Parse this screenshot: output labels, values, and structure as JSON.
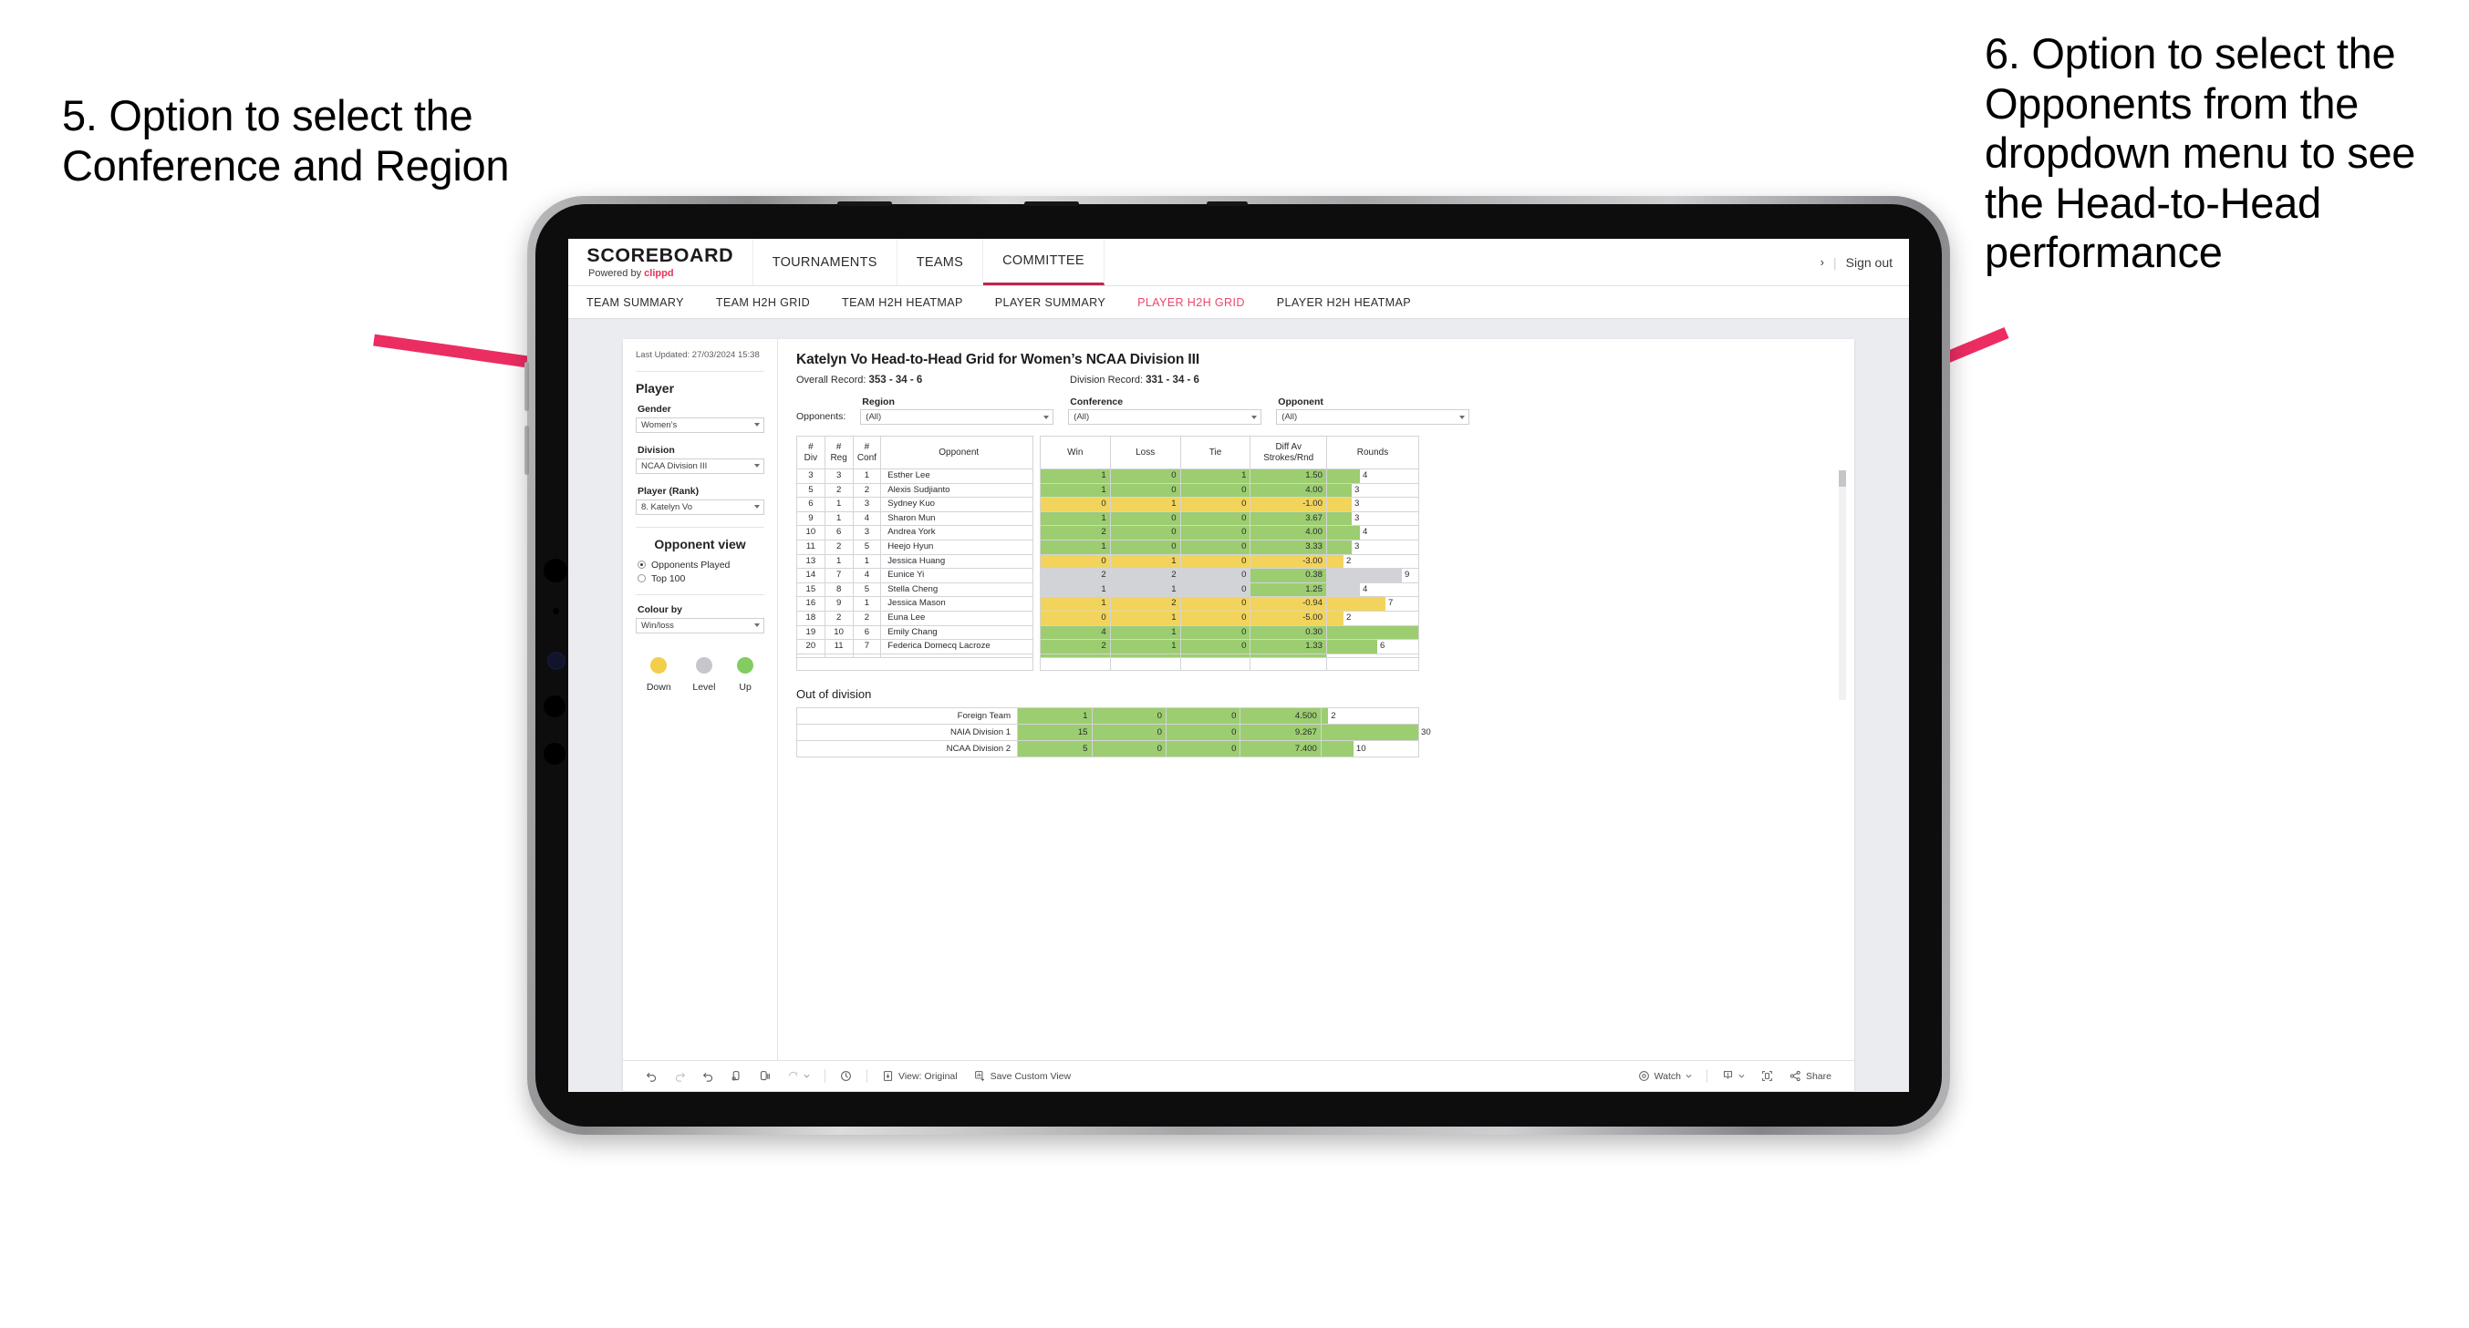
{
  "annotations": {
    "left": "5. Option to select the Conference and Region",
    "right": "6. Option to select the Opponents from the dropdown menu to see the Head-to-Head performance"
  },
  "header": {
    "brand_title": "SCOREBOARD",
    "brand_sub_prefix": "Powered by ",
    "brand_sub_accent": "clippd",
    "nav_tabs": [
      {
        "label": "TOURNAMENTS",
        "active": false
      },
      {
        "label": "TEAMS",
        "active": false
      },
      {
        "label": "COMMITTEE",
        "active": true
      }
    ],
    "user_chevron": "›",
    "separator": "|",
    "sign_out": "Sign out"
  },
  "subnav": [
    {
      "label": "TEAM SUMMARY",
      "active": false
    },
    {
      "label": "TEAM H2H GRID",
      "active": false
    },
    {
      "label": "TEAM H2H HEATMAP",
      "active": false
    },
    {
      "label": "PLAYER SUMMARY",
      "active": false
    },
    {
      "label": "PLAYER H2H GRID",
      "active": true
    },
    {
      "label": "PLAYER H2H HEATMAP",
      "active": false
    }
  ],
  "sidebar": {
    "last_updated": "Last Updated: 27/03/2024 15:38",
    "player_heading": "Player",
    "gender_label": "Gender",
    "gender_value": "Women’s",
    "division_label": "Division",
    "division_value": "NCAA Division III",
    "player_rank_label": "Player (Rank)",
    "player_rank_value": "8. Katelyn Vo",
    "opponent_view_heading": "Opponent view",
    "opponent_view_options": [
      {
        "label": "Opponents Played",
        "selected": true
      },
      {
        "label": "Top 100",
        "selected": false
      }
    ],
    "colour_by_label": "Colour by",
    "colour_by_value": "Win/loss",
    "legend": [
      {
        "label": "Down",
        "color": "#f2cf4a"
      },
      {
        "label": "Level",
        "color": "#c6c6cb"
      },
      {
        "label": "Up",
        "color": "#83cc60"
      }
    ]
  },
  "main": {
    "title": "Katelyn Vo Head-to-Head Grid for Women’s NCAA Division III",
    "overall_record_label": "Overall Record: ",
    "overall_record_value": "353 - 34 - 6",
    "division_record_label": "Division Record: ",
    "division_record_value": "331 - 34 - 6",
    "opponents_lead": "Opponents:",
    "filters": [
      {
        "label": "Region",
        "value": "(All)"
      },
      {
        "label": "Conference",
        "value": "(All)"
      },
      {
        "label": "Opponent",
        "value": "(All)"
      }
    ]
  },
  "chart_data": {
    "type": "table",
    "title": "Katelyn Vo Head-to-Head Grid for Women's NCAA Division III",
    "columns": [
      "# Div",
      "# Reg",
      "# Conf",
      "Opponent",
      "Win",
      "Loss",
      "Tie",
      "Diff Av Strokes/Rnd",
      "Rounds"
    ],
    "column_headers_two_line": [
      {
        "top": "#",
        "bottom": "Div"
      },
      {
        "top": "#",
        "bottom": "Reg"
      },
      {
        "top": "#",
        "bottom": "Conf"
      },
      {
        "top": "Opponent",
        "bottom": ""
      },
      {
        "top": "Win",
        "bottom": ""
      },
      {
        "top": "Loss",
        "bottom": ""
      },
      {
        "top": "Tie",
        "bottom": ""
      },
      {
        "top": "Diff Av",
        "bottom": "Strokes/Rnd"
      },
      {
        "top": "Rounds",
        "bottom": ""
      }
    ],
    "rows": [
      {
        "div": "3",
        "reg": "3",
        "conf": "1",
        "opponent": "Esther Lee",
        "win": "1",
        "loss": "0",
        "tie": "1",
        "diff": "1.50",
        "rounds": "4",
        "state": "up",
        "bar_pct": 36
      },
      {
        "div": "5",
        "reg": "2",
        "conf": "2",
        "opponent": "Alexis Sudjianto",
        "win": "1",
        "loss": "0",
        "tie": "0",
        "diff": "4.00",
        "rounds": "3",
        "state": "up",
        "bar_pct": 27
      },
      {
        "div": "6",
        "reg": "1",
        "conf": "3",
        "opponent": "Sydney Kuo",
        "win": "0",
        "loss": "1",
        "tie": "0",
        "diff": "-1.00",
        "rounds": "3",
        "state": "down",
        "bar_pct": 27
      },
      {
        "div": "9",
        "reg": "1",
        "conf": "4",
        "opponent": "Sharon Mun",
        "win": "1",
        "loss": "0",
        "tie": "0",
        "diff": "3.67",
        "rounds": "3",
        "state": "up",
        "bar_pct": 27
      },
      {
        "div": "10",
        "reg": "6",
        "conf": "3",
        "opponent": "Andrea York",
        "win": "2",
        "loss": "0",
        "tie": "0",
        "diff": "4.00",
        "rounds": "4",
        "state": "up",
        "bar_pct": 36
      },
      {
        "div": "11",
        "reg": "2",
        "conf": "5",
        "opponent": "Heejo Hyun",
        "win": "1",
        "loss": "0",
        "tie": "0",
        "diff": "3.33",
        "rounds": "3",
        "state": "up",
        "bar_pct": 27
      },
      {
        "div": "13",
        "reg": "1",
        "conf": "1",
        "opponent": "Jessica Huang",
        "win": "0",
        "loss": "1",
        "tie": "0",
        "diff": "-3.00",
        "rounds": "2",
        "state": "down",
        "bar_pct": 18
      },
      {
        "div": "14",
        "reg": "7",
        "conf": "4",
        "opponent": "Eunice Yi",
        "win": "2",
        "loss": "2",
        "tie": "0",
        "diff": "0.38",
        "rounds": "9",
        "state": "level",
        "bar_pct": 82,
        "diff_state": "up"
      },
      {
        "div": "15",
        "reg": "8",
        "conf": "5",
        "opponent": "Stella Cheng",
        "win": "1",
        "loss": "1",
        "tie": "0",
        "diff": "1.25",
        "rounds": "4",
        "state": "level",
        "bar_pct": 36,
        "diff_state": "up"
      },
      {
        "div": "16",
        "reg": "9",
        "conf": "1",
        "opponent": "Jessica Mason",
        "win": "1",
        "loss": "2",
        "tie": "0",
        "diff": "-0.94",
        "rounds": "7",
        "state": "down",
        "bar_pct": 64
      },
      {
        "div": "18",
        "reg": "2",
        "conf": "2",
        "opponent": "Euna Lee",
        "win": "0",
        "loss": "1",
        "tie": "0",
        "diff": "-5.00",
        "rounds": "2",
        "state": "down",
        "bar_pct": 18
      },
      {
        "div": "19",
        "reg": "10",
        "conf": "6",
        "opponent": "Emily Chang",
        "win": "4",
        "loss": "1",
        "tie": "0",
        "diff": "0.30",
        "rounds": "11",
        "state": "up",
        "bar_pct": 100
      },
      {
        "div": "20",
        "reg": "11",
        "conf": "7",
        "opponent": "Federica Domecq Lacroze",
        "win": "2",
        "loss": "1",
        "tie": "0",
        "diff": "1.33",
        "rounds": "6",
        "state": "up",
        "bar_pct": 55
      }
    ],
    "out_of_division": {
      "title": "Out of division",
      "rows": [
        {
          "label": "Foreign Team",
          "win": "1",
          "loss": "0",
          "tie": "0",
          "diff": "4.500",
          "rounds": "2",
          "state": "up",
          "bar_pct": 7
        },
        {
          "label": "NAIA Division 1",
          "win": "15",
          "loss": "0",
          "tie": "0",
          "diff": "9.267",
          "rounds": "30",
          "state": "up",
          "bar_pct": 100
        },
        {
          "label": "NCAA Division 2",
          "win": "5",
          "loss": "0",
          "tie": "0",
          "diff": "7.400",
          "rounds": "10",
          "state": "up",
          "bar_pct": 33
        }
      ]
    },
    "colors": {
      "up": "#9ccd70",
      "down": "#f2d45c",
      "level": "#d2d3d6"
    }
  },
  "toolbar": {
    "view_label": "View: Original",
    "save_label": "Save Custom View",
    "watch_label": "Watch",
    "share_label": "Share"
  }
}
